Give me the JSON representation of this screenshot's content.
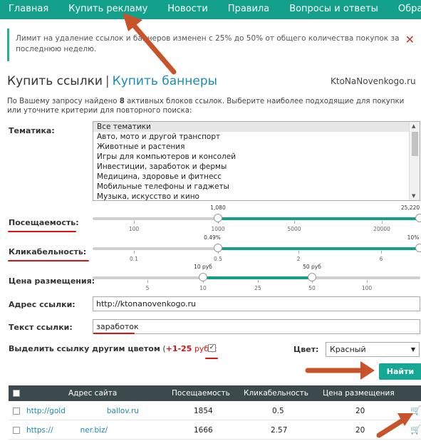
{
  "nav": {
    "items": [
      "Главная",
      "Купить рекламу",
      "Новости",
      "Правила",
      "Вопросы и ответы",
      "Обратн"
    ]
  },
  "notice": {
    "text": "Лимит на удаление ссылок и баннеров изменен с 25% до 50% от общего количества покупок за последнюю неделю.",
    "close": "✕"
  },
  "header": {
    "buy_links": "Купить ссылки",
    "separator": "|",
    "buy_banners": "Купить баннеры",
    "site_name": "KtoNaNovenkogo.ru"
  },
  "intro": {
    "before": "По Вашему запросу найдено ",
    "count": "8",
    "after": " активных блоков ссылок. Выберите наиболее подходящие для покупки или уточните критерии для повторного поиска:"
  },
  "form": {
    "topic_label": "Тематика:",
    "topics": [
      "Все тематики",
      "Авто, мото и другой транспорт",
      "Животные и растения",
      "Игры для компьютеров и консолей",
      "Инвестиции, заработок и фермы",
      "Медицина, здоровье и фитнесс",
      "Мобильные телефоны и гаджеты",
      "Музыка, искусство и кино"
    ],
    "traffic_label": "Посещаемость:",
    "traffic_low": "1,080",
    "traffic_high": "25,220",
    "traffic_ticks": [
      "100",
      "1000",
      "5000",
      "20000"
    ],
    "ctr_label": "Кликабельность:",
    "ctr_low": "0.49%",
    "ctr_high": "10%",
    "ctr_ticks": [
      "0.1",
      "0.5",
      "2",
      "6"
    ],
    "price_label": "Цена размещения:",
    "price_low": "10 руб",
    "price_high": "50 руб",
    "price_ticks": [
      "5",
      "10",
      "25",
      "50",
      "100"
    ],
    "url_label": "Адрес ссылки:",
    "url_value": "http://ktonanovenkogo.ru",
    "text_label": "Текст ссылки:",
    "text_value": "заработок",
    "highlight_label": "Выделить ссылку другим цветом",
    "highlight_pre": " (",
    "highlight_plus": "+1-25",
    "highlight_rub": " руб.",
    "highlight_post": "):",
    "highlight_check": "✓",
    "color_label": "Цвет:",
    "color_value": "Красный",
    "find_button": "Найти"
  },
  "table": {
    "headers": [
      "Адрес сайта",
      "Посещаемость",
      "Кликабельность",
      "Цена размещения"
    ],
    "rows": [
      {
        "url": "http://gold",
        "url_tail": "ballov.ru",
        "traffic": "1854",
        "ctr": "0.5",
        "price": "20"
      },
      {
        "url": "https://",
        "url_tail": "ner.biz/",
        "traffic": "1666",
        "ctr": "2.57",
        "price": "20"
      }
    ]
  },
  "colors": {
    "nav_bg": "#12a08a",
    "accent": "#15a894",
    "link": "#1a8db6",
    "annotation_red": "#d11",
    "arrow": "#c8522a"
  },
  "icons": {
    "close": "close-icon",
    "cart": "cart-icon",
    "dropdown": "chevron-down-icon"
  }
}
